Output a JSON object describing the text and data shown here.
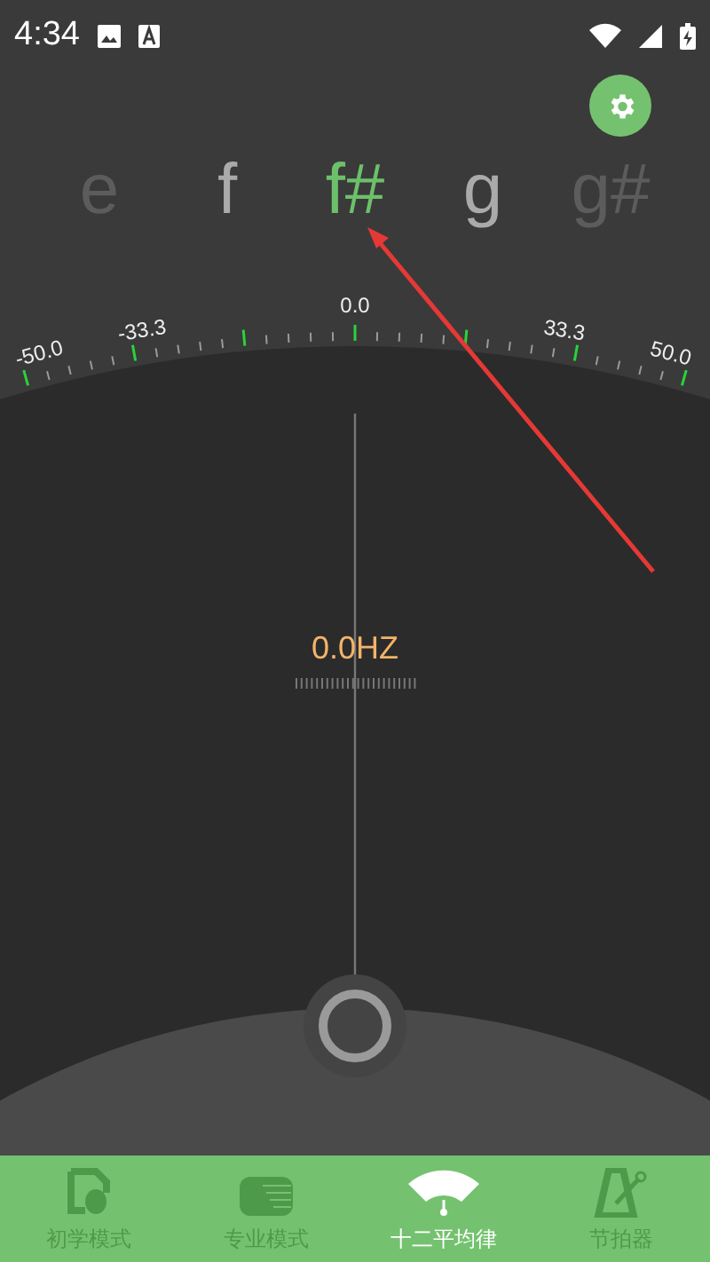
{
  "status_bar": {
    "time": "4:34"
  },
  "notes": [
    {
      "label": "e",
      "selected": false
    },
    {
      "label": "f",
      "selected": false
    },
    {
      "label": "f#",
      "selected": true
    },
    {
      "label": "g",
      "selected": false
    },
    {
      "label": "g#",
      "selected": false
    }
  ],
  "scale": {
    "labels": [
      "-50.0",
      "-33.3",
      "0.0",
      "33.3",
      "50.0"
    ]
  },
  "frequency": "0.0HZ",
  "nav": [
    {
      "label": "初学模式",
      "selected": false
    },
    {
      "label": "专业模式",
      "selected": false
    },
    {
      "label": "十二平均律",
      "selected": true
    },
    {
      "label": "节拍器",
      "selected": false
    }
  ]
}
